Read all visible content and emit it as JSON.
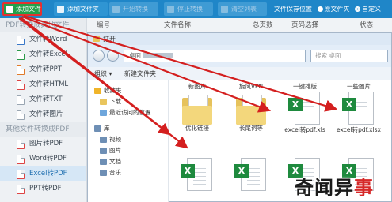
{
  "toolbar": {
    "add_file": "添加文件",
    "add_folder": "添加文件夹",
    "start_convert": "开始转换",
    "stop_convert": "停止转换",
    "clear_list": "清空列表",
    "save_location_label": "文件保存位置",
    "option_original_folder": "原文件夹",
    "option_custom": "自定义"
  },
  "list_header": {
    "col_index": "编号",
    "col_name": "文件名称",
    "col_pages": "总页数",
    "col_page_select": "页码选择",
    "col_status": "状态"
  },
  "sidebar": {
    "section1": "PDF转换成其他文件",
    "section1_items": [
      "文件转Word",
      "文件转Excel",
      "文件转PPT",
      "文件转HTML",
      "文件转TXT",
      "文件转图片"
    ],
    "section2": "其他文件转换成PDF",
    "section2_items": [
      "图片转PDF",
      "Word转PDF",
      "Excel转PDF",
      "PPT转PDF"
    ]
  },
  "explorer": {
    "title": "打开",
    "address_root": "桌面",
    "search_placeholder": "搜索 桌面",
    "organize": "组织 ▾",
    "new_folder": "新建文件夹",
    "tree": {
      "favorites": "收藏夹",
      "downloads": "下载",
      "recent": "最近访问的位置",
      "libraries": "库",
      "videos": "视频",
      "pictures": "图片",
      "documents": "文档",
      "music": "音乐"
    },
    "top_labels": [
      "新图片",
      "旋风VPN",
      "一键排版",
      "一些图片"
    ],
    "files": [
      {
        "name": "优化链接",
        "kind": "folder"
      },
      {
        "name": "长尾词等",
        "kind": "folder"
      },
      {
        "name": "excel转pdf.xls",
        "kind": "excel"
      },
      {
        "name": "excel转pdf.xlsx",
        "kind": "excel"
      },
      {
        "name": "",
        "kind": "excel"
      },
      {
        "name": "",
        "kind": "excel"
      },
      {
        "name": "",
        "kind": "excel"
      },
      {
        "name": "",
        "kind": "excel"
      }
    ],
    "excel_badge": "X"
  },
  "watermark": {
    "text_a": "奇闻异",
    "text_b": "事"
  },
  "colors": {
    "toolbar": "#1f86c8",
    "add_button": "#23a04b",
    "highlight": "#e53030",
    "arrow": "#d41f1f",
    "excel": "#1e8a3e"
  }
}
